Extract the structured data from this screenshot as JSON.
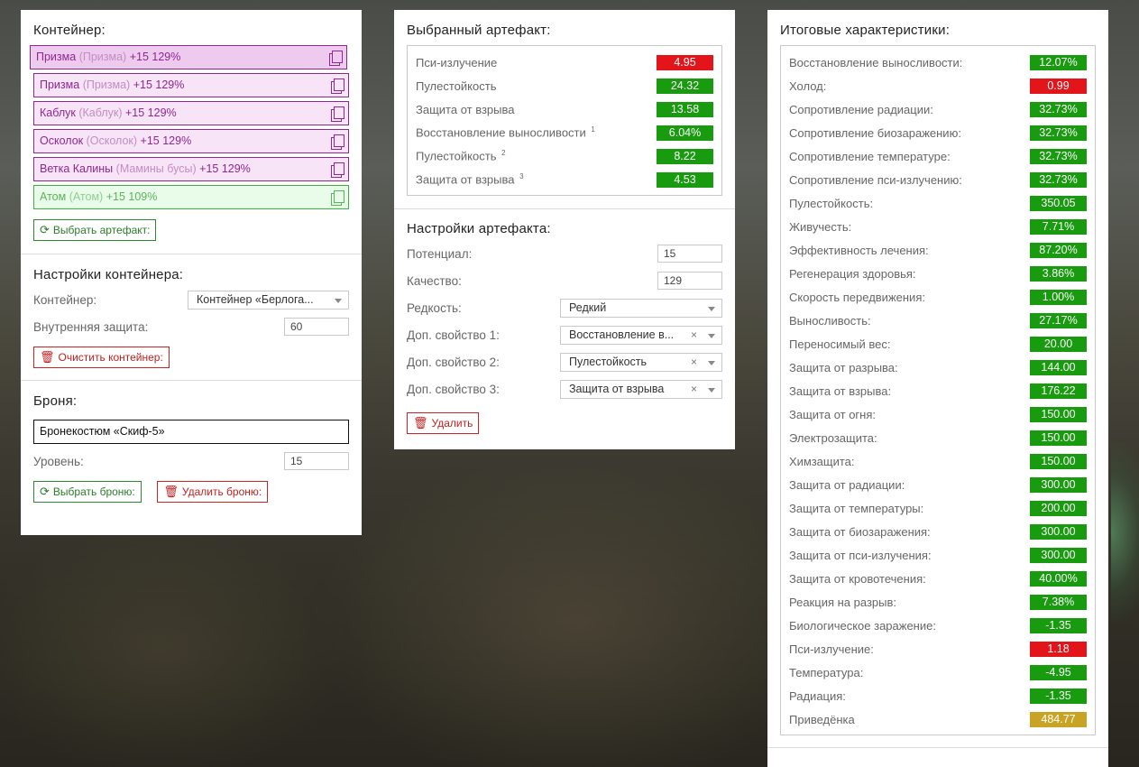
{
  "container_panel": {
    "title": "Контейнер:",
    "artifacts": [
      {
        "name": "Призма",
        "sub": "(Призма)",
        "bonus": "+15 129%",
        "style": "sel"
      },
      {
        "name": "Призма",
        "sub": "(Призма)",
        "bonus": "+15 129%",
        "style": "purple"
      },
      {
        "name": "Каблук",
        "sub": "(Каблук)",
        "bonus": "+15 129%",
        "style": "purple"
      },
      {
        "name": "Осколок",
        "sub": "(Осколок)",
        "bonus": "+15 129%",
        "style": "purple"
      },
      {
        "name": "Ветка Калины",
        "sub": "(Мамины бусы)",
        "bonus": "+15 129%",
        "style": "purple"
      },
      {
        "name": "Атом",
        "sub": "(Атом)",
        "bonus": "+15 109%",
        "style": "green"
      }
    ],
    "select_artifact_button": "Выбрать артефакт:",
    "settings_title": "Настройки контейнера:",
    "container_label": "Контейнер:",
    "container_value": "Контейнер «Берлога...",
    "inner_protection_label": "Внутренняя защита:",
    "inner_protection_value": "60",
    "clear_button": "Очистить контейнер:",
    "armor_title": "Броня:",
    "armor_value": "Бронекостюм «Скиф-5»",
    "level_label": "Уровень:",
    "level_value": "15",
    "select_armor_button": "Выбрать броню:",
    "delete_armor_button": "Удалить броню:"
  },
  "artifact_panel": {
    "title": "Выбранный артефакт:",
    "stats": [
      {
        "label": "Пси-излучение",
        "sup": "",
        "value": "4.95",
        "color": "red"
      },
      {
        "label": "Пулестойкость",
        "sup": "",
        "value": "24.32",
        "color": "green"
      },
      {
        "label": "Защита от взрыва",
        "sup": "",
        "value": "13.58",
        "color": "green"
      },
      {
        "label": "Восстановление выносливости",
        "sup": "1",
        "value": "6.04%",
        "color": "green"
      },
      {
        "label": "Пулестойкость",
        "sup": "2",
        "value": "8.22",
        "color": "green"
      },
      {
        "label": "Защита от взрыва",
        "sup": "3",
        "value": "4.53",
        "color": "green"
      }
    ],
    "settings_title": "Настройки артефакта:",
    "potential_label": "Потенциал:",
    "potential_value": "15",
    "quality_label": "Качество:",
    "quality_value": "129",
    "rarity_label": "Редкость:",
    "rarity_value": "Редкий",
    "extra1_label": "Доп. свойство 1:",
    "extra1_value": "Восстановление в...",
    "extra2_label": "Доп. свойство 2:",
    "extra2_value": "Пулестойкость",
    "extra3_label": "Доп. свойство 3:",
    "extra3_value": "Защита от взрыва",
    "delete_button": "Удалить"
  },
  "totals_panel": {
    "title": "Итоговые характеристики:",
    "stats": [
      {
        "label": "Восстановление выносливости:",
        "value": "12.07%",
        "color": "green"
      },
      {
        "label": "Холод:",
        "value": "0.99",
        "color": "red"
      },
      {
        "label": "Сопротивление радиации:",
        "value": "32.73%",
        "color": "green"
      },
      {
        "label": "Сопротивление биозаражению:",
        "value": "32.73%",
        "color": "green"
      },
      {
        "label": "Сопротивление температуре:",
        "value": "32.73%",
        "color": "green"
      },
      {
        "label": "Сопротивление пси-излучению:",
        "value": "32.73%",
        "color": "green"
      },
      {
        "label": "Пулестойкость:",
        "value": "350.05",
        "color": "green"
      },
      {
        "label": "Живучесть:",
        "value": "7.71%",
        "color": "green"
      },
      {
        "label": "Эффективность лечения:",
        "value": "87.20%",
        "color": "green"
      },
      {
        "label": "Регенерация здоровья:",
        "value": "3.86%",
        "color": "green"
      },
      {
        "label": "Скорость передвижения:",
        "value": "1.00%",
        "color": "green"
      },
      {
        "label": "Выносливость:",
        "value": "27.17%",
        "color": "green"
      },
      {
        "label": "Переносимый вес:",
        "value": "20.00",
        "color": "green"
      },
      {
        "label": "Защита от разрыва:",
        "value": "144.00",
        "color": "green"
      },
      {
        "label": "Защита от взрыва:",
        "value": "176.22",
        "color": "green"
      },
      {
        "label": "Защита от огня:",
        "value": "150.00",
        "color": "green"
      },
      {
        "label": "Электрозащита:",
        "value": "150.00",
        "color": "green"
      },
      {
        "label": "Химзащита:",
        "value": "150.00",
        "color": "green"
      },
      {
        "label": "Защита от радиации:",
        "value": "300.00",
        "color": "green"
      },
      {
        "label": "Защита от температуры:",
        "value": "200.00",
        "color": "green"
      },
      {
        "label": "Защита от биозаражения:",
        "value": "300.00",
        "color": "green"
      },
      {
        "label": "Защита от пси-излучения:",
        "value": "300.00",
        "color": "green"
      },
      {
        "label": "Защита от кровотечения:",
        "value": "40.00%",
        "color": "green"
      },
      {
        "label": "Реакция на разрыв:",
        "value": "7.38%",
        "color": "green"
      },
      {
        "label": "Биологическое заражение:",
        "value": "-1.35",
        "color": "green"
      },
      {
        "label": "Пси-излучение:",
        "value": "1.18",
        "color": "red"
      },
      {
        "label": "Температура:",
        "value": "-4.95",
        "color": "green"
      },
      {
        "label": "Радиация:",
        "value": "-1.35",
        "color": "green"
      },
      {
        "label": "Приведёнка",
        "value": "484.77",
        "color": "gold"
      }
    ]
  },
  "colors": {
    "green": "#199b0f",
    "red": "#e3151b",
    "gold": "#c8a324",
    "purple": "#8e2790"
  }
}
